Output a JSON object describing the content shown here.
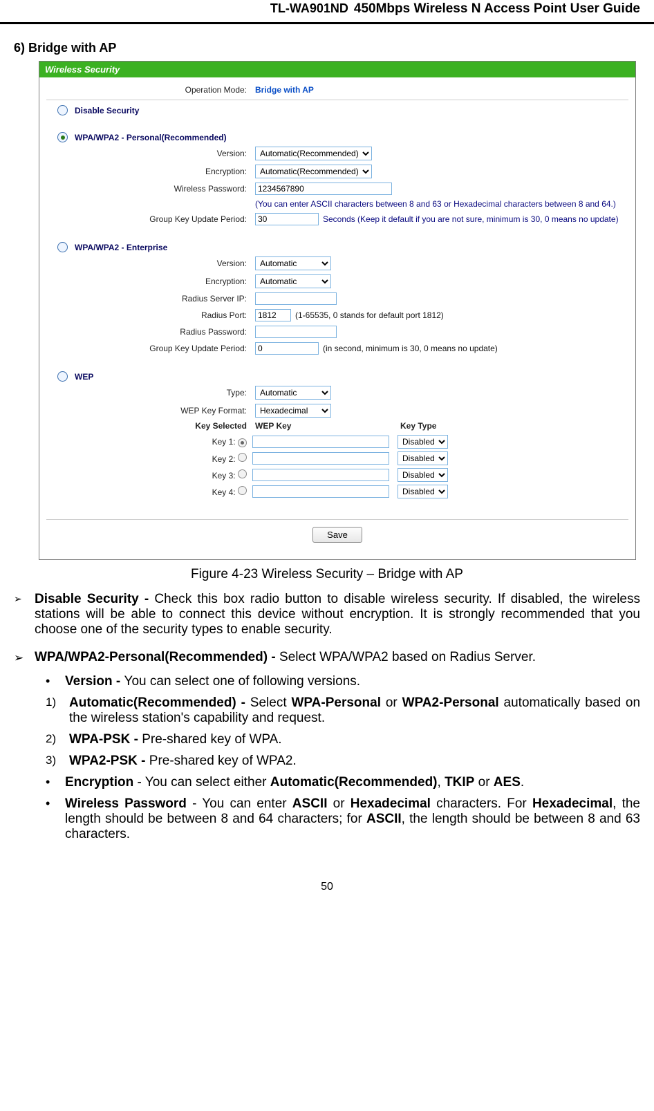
{
  "header": {
    "model": "TL-WA901ND",
    "title": "450Mbps Wireless N Access Point User Guide"
  },
  "section": {
    "label": "6)   Bridge with AP"
  },
  "figure": {
    "panel_title": "Wireless Security",
    "op_mode_label": "Operation Mode:",
    "op_mode_value": "Bridge with AP",
    "disable_security": "Disable Security",
    "wpa_personal_title": "WPA/WPA2 - Personal(Recommended)",
    "personal": {
      "version_label": "Version:",
      "version_value": "Automatic(Recommended)",
      "encryption_label": "Encryption:",
      "encryption_value": "Automatic(Recommended)",
      "password_label": "Wireless Password:",
      "password_value": "1234567890",
      "password_hint": "(You can enter ASCII characters between 8 and 63 or Hexadecimal characters between 8 and 64.)",
      "gkup_label": "Group Key Update Period:",
      "gkup_value": "30",
      "gkup_hint": "Seconds (Keep it default if you are not sure, minimum is 30, 0 means no update)"
    },
    "wpa_enterprise_title": "WPA/WPA2 - Enterprise",
    "enterprise": {
      "version_label": "Version:",
      "version_value": "Automatic",
      "encryption_label": "Encryption:",
      "encryption_value": "Automatic",
      "radius_ip_label": "Radius Server IP:",
      "radius_ip_value": "",
      "radius_port_label": "Radius Port:",
      "radius_port_value": "1812",
      "radius_port_hint": "(1-65535, 0 stands for default port 1812)",
      "radius_pw_label": "Radius Password:",
      "radius_pw_value": "",
      "gkup_label": "Group Key Update Period:",
      "gkup_value": "0",
      "gkup_hint": "(in second, minimum is 30, 0 means no update)"
    },
    "wep_title": "WEP",
    "wep": {
      "type_label": "Type:",
      "type_value": "Automatic",
      "format_label": "WEP Key Format:",
      "format_value": "Hexadecimal",
      "hdr_key_selected": "Key Selected",
      "hdr_wep_key": "WEP Key",
      "hdr_key_type": "Key Type",
      "rows": [
        {
          "label": "Key 1:",
          "value": "",
          "type": "Disabled"
        },
        {
          "label": "Key 2:",
          "value": "",
          "type": "Disabled"
        },
        {
          "label": "Key 3:",
          "value": "",
          "type": "Disabled"
        },
        {
          "label": "Key 4:",
          "value": "",
          "type": "Disabled"
        }
      ]
    },
    "save_label": "Save"
  },
  "caption": "Figure 4-23 Wireless Security – Bridge with AP",
  "body": {
    "disable_bold": "Disable Security - ",
    "disable_text": "Check this box radio button to disable wireless security. If disabled, the wireless stations will be able to connect this device without encryption. It is strongly recommended that you choose one of the security types to enable security.",
    "wpa_bold": "WPA/WPA2-Personal(Recommended) - ",
    "wpa_text": "Select WPA/WPA2 based on Radius Server.",
    "version_bold": "Version - ",
    "version_text": "You can select one of following versions.",
    "l1_bold": "Automatic(Recommended) - ",
    "l1_t1": "Select ",
    "l1_b1": "WPA-Personal",
    "l1_t2": " or ",
    "l1_b2": "WPA2-Personal",
    "l1_t3": " automatically based on the wireless station's capability and request.",
    "l2_bold": "WPA-PSK - ",
    "l2_text": "Pre-shared key of WPA.",
    "l3_bold": "WPA2-PSK - ",
    "l3_text": "Pre-shared key of WPA2.",
    "enc_bold": "Encryption",
    "enc_t1": " - You can select either ",
    "enc_b1": "Automatic(Recommended)",
    "enc_t2": ", ",
    "enc_b2": "TKIP",
    "enc_t3": " or ",
    "enc_b3": "AES",
    "enc_t4": ".",
    "wp_bold": "Wireless Password",
    "wp_t1": " - You can enter ",
    "wp_b1": "ASCII",
    "wp_t2": " or ",
    "wp_b2": "Hexadecimal",
    "wp_t3": " characters. For ",
    "wp_b3": "Hexadecimal",
    "wp_t4": ", the length should be between 8 and 64 characters; for ",
    "wp_b4": "ASCII",
    "wp_t5": ", the length should be between 8 and 63 characters."
  },
  "page_number": "50"
}
